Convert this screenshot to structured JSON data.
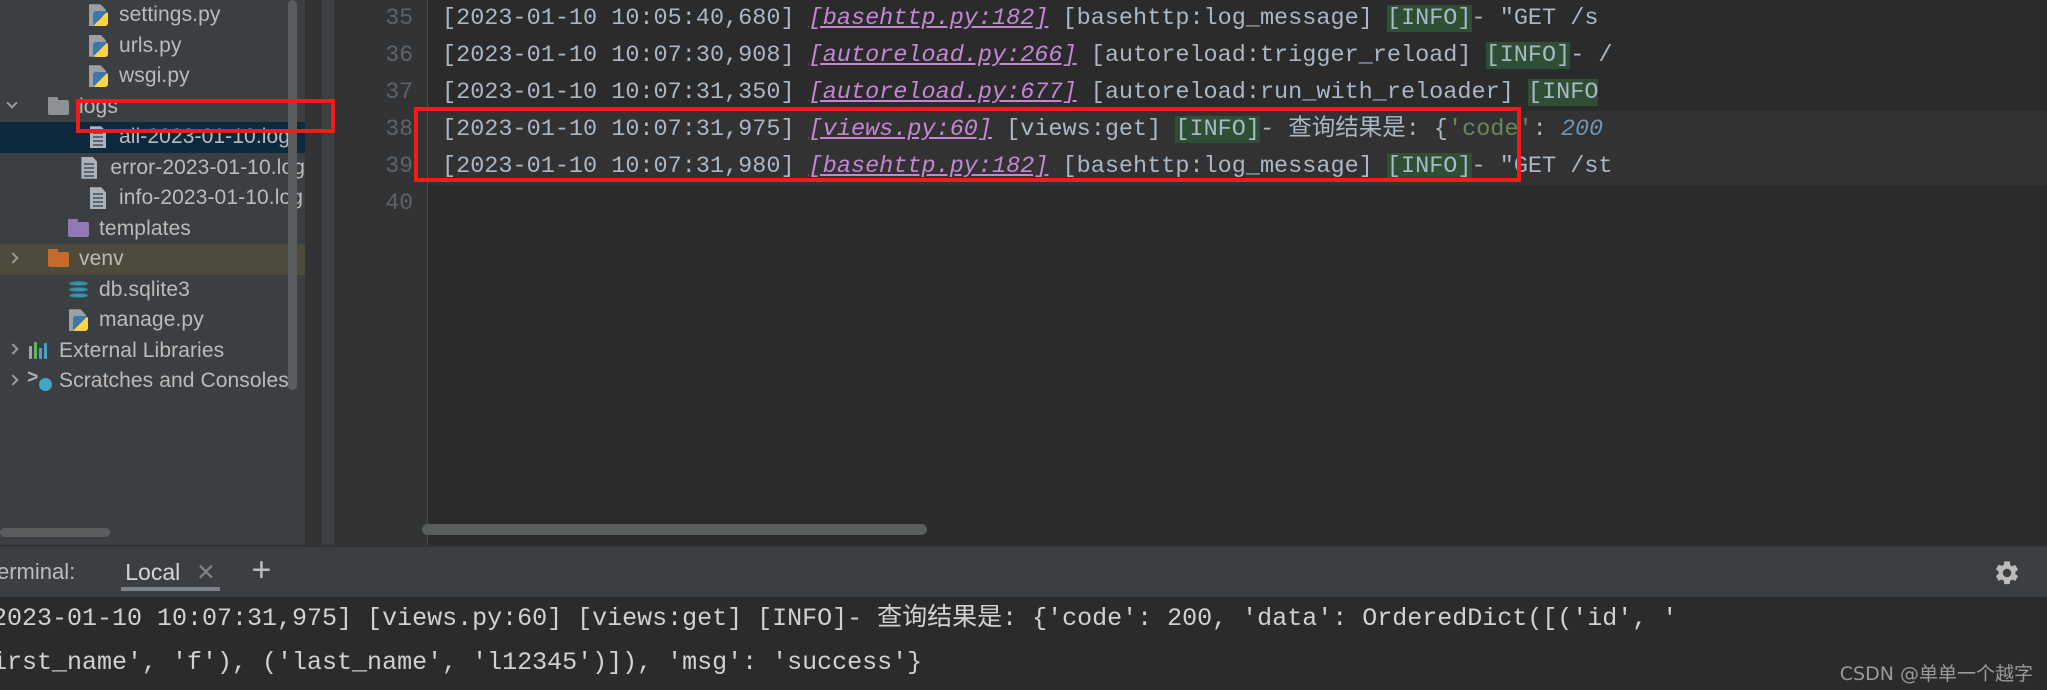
{
  "sidebar": {
    "items": [
      {
        "label": "settings.py",
        "icon": "python-file-icon",
        "indent": 60,
        "arrow": "none",
        "state": "normal"
      },
      {
        "label": "urls.py",
        "icon": "python-file-icon",
        "indent": 60,
        "arrow": "none",
        "state": "normal"
      },
      {
        "label": "wsgi.py",
        "icon": "python-file-icon",
        "indent": 60,
        "arrow": "none",
        "state": "normal"
      },
      {
        "label": "logs",
        "icon": "folder-icon",
        "color": "#8d9195",
        "indent": 20,
        "arrow": "down",
        "state": "normal"
      },
      {
        "label": "all-2023-01-10.log",
        "icon": "log-file-icon",
        "indent": 60,
        "arrow": "none",
        "state": "selected"
      },
      {
        "label": "error-2023-01-10.log",
        "icon": "log-file-icon",
        "indent": 60,
        "arrow": "none",
        "state": "normal"
      },
      {
        "label": "info-2023-01-10.log",
        "icon": "log-file-icon",
        "indent": 60,
        "arrow": "none",
        "state": "normal"
      },
      {
        "label": "templates",
        "icon": "folder-icon",
        "color": "#9179b8",
        "indent": 40,
        "arrow": "none",
        "state": "normal"
      },
      {
        "label": "venv",
        "icon": "folder-icon",
        "color": "#c26b2a",
        "indent": 20,
        "arrow": "right",
        "state": "hover"
      },
      {
        "label": "db.sqlite3",
        "icon": "database-icon",
        "indent": 40,
        "arrow": "none",
        "state": "normal"
      },
      {
        "label": "manage.py",
        "icon": "python-file-icon",
        "indent": 40,
        "arrow": "none",
        "state": "normal"
      },
      {
        "label": "External Libraries",
        "icon": "external-libraries-icon",
        "indent": 0,
        "arrow": "right",
        "state": "normal"
      },
      {
        "label": "Scratches and Consoles",
        "icon": "scratches-icon",
        "indent": 0,
        "arrow": "right",
        "state": "normal"
      }
    ]
  },
  "editor": {
    "line_numbers": [
      "35",
      "36",
      "37",
      "38",
      "39",
      "40"
    ],
    "lines": [
      {
        "number": "35",
        "segments": [
          {
            "text": "[2023-01-10 10:05:40,680] ",
            "style": "plain"
          },
          {
            "text": "[basehttp.py:182]",
            "style": "file"
          },
          {
            "text": " [basehttp:log_message] ",
            "style": "plain"
          },
          {
            "text": "[INFO]",
            "style": "info"
          },
          {
            "text": "- \"GET /s",
            "style": "plain"
          }
        ]
      },
      {
        "number": "36",
        "segments": [
          {
            "text": "[2023-01-10 10:07:30,908] ",
            "style": "plain"
          },
          {
            "text": "[autoreload.py:266]",
            "style": "file"
          },
          {
            "text": " [autoreload:trigger_reload] ",
            "style": "plain"
          },
          {
            "text": "[INFO]",
            "style": "info"
          },
          {
            "text": "- /",
            "style": "plain"
          }
        ]
      },
      {
        "number": "37",
        "segments": [
          {
            "text": "[2023-01-10 10:07:31,350] ",
            "style": "plain"
          },
          {
            "text": "[autoreload.py:677]",
            "style": "file"
          },
          {
            "text": " [autoreload:run_with_reloader] ",
            "style": "plain"
          },
          {
            "text": "[INFO",
            "style": "info"
          }
        ]
      },
      {
        "number": "38",
        "segments": [
          {
            "text": "[2023-01-10 10:07:31,975] ",
            "style": "plain"
          },
          {
            "text": "[views.py:60]",
            "style": "file"
          },
          {
            "text": " [views:get] ",
            "style": "plain"
          },
          {
            "text": "[INFO]",
            "style": "info"
          },
          {
            "text": "- 查询结果是: {",
            "style": "plain"
          },
          {
            "text": "'code'",
            "style": "string"
          },
          {
            "text": ": ",
            "style": "plain"
          },
          {
            "text": "200",
            "style": "number"
          }
        ]
      },
      {
        "number": "39",
        "segments": [
          {
            "text": "[2023-01-10 10:07:31,980] ",
            "style": "plain"
          },
          {
            "text": "[basehttp.py:182]",
            "style": "file"
          },
          {
            "text": " [basehttp:log_message] ",
            "style": "plain"
          },
          {
            "text": "[INFO]",
            "style": "info"
          },
          {
            "text": "- \"GET /st",
            "style": "plain"
          }
        ]
      },
      {
        "number": "40",
        "segments": []
      }
    ]
  },
  "annotations": {
    "sidebar_highlight": "all-2023-01-10.log",
    "editor_highlight_lines": [
      "38",
      "39"
    ],
    "box_color": "#f21b1b"
  },
  "terminal": {
    "title": "Terminal:",
    "tab_label": "Local",
    "close_icon": "close-icon",
    "add_icon": "plus-icon",
    "settings_icon": "gear-icon",
    "output_lines": [
      "2023-01-10 10:07:31,975] [views.py:60] [views:get] [INFO]- 查询结果是: {'code': 200, 'data': OrderedDict([('id', '",
      "irst_name', 'f'), ('last_name', 'l12345')]), 'msg': 'success'}"
    ]
  },
  "watermark": {
    "text": "CSDN @单单一个越字"
  }
}
